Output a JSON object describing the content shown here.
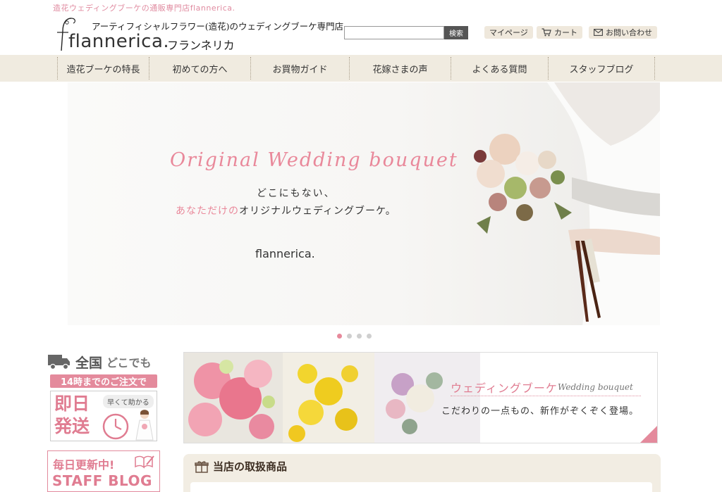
{
  "header": {
    "tagline": "造花ウェディングブーケの通販専門店flannerica.",
    "logo_word": "flannerica.",
    "logo_sub": "アーティフィシャルフラワー(造花)のウェディングブーケ専門店",
    "logo_kana": "フランネリカ"
  },
  "search": {
    "value": "",
    "button_label": "検索"
  },
  "top_links": {
    "mypage": "マイページ",
    "cart": "カート",
    "contact": "お問い合わせ"
  },
  "nav": {
    "items": [
      {
        "label": "造花ブーケの特長"
      },
      {
        "label": "初めての方へ"
      },
      {
        "label": "お買物ガイド"
      },
      {
        "label": "花嫁さまの声"
      },
      {
        "label": "よくある質問"
      },
      {
        "label": "スタッフブログ"
      }
    ]
  },
  "hero": {
    "title": "Original Wedding bouquet",
    "line1": "どこにもない、",
    "line2_pink": "あなただけの",
    "line2_rest": "オリジナルウェディングブーケ。",
    "logo": "flannerica."
  },
  "slider": {
    "count": 4,
    "active": 0
  },
  "shipping_banner": {
    "line1_a": "全国",
    "line1_b": "どこでも",
    "deadline": "14時までのご注文で",
    "big1": "即日",
    "big2": "発送",
    "bubble": "早くて助かる"
  },
  "blog_banner": {
    "line1": "毎日更新中!",
    "line2": "STAFF BLOG"
  },
  "wedding_banner": {
    "title": "ウェディングブーケ",
    "title_en": "Wedding bouquet",
    "subtitle": "こだわりの一点もの、新作がぞくぞく登場。"
  },
  "section": {
    "title": "当店の取扱商品"
  },
  "colors": {
    "accent_pink": "#e48a9c",
    "nav_bg": "#f0ebe0",
    "button_bg": "#efe8dc",
    "search_button": "#555555"
  }
}
